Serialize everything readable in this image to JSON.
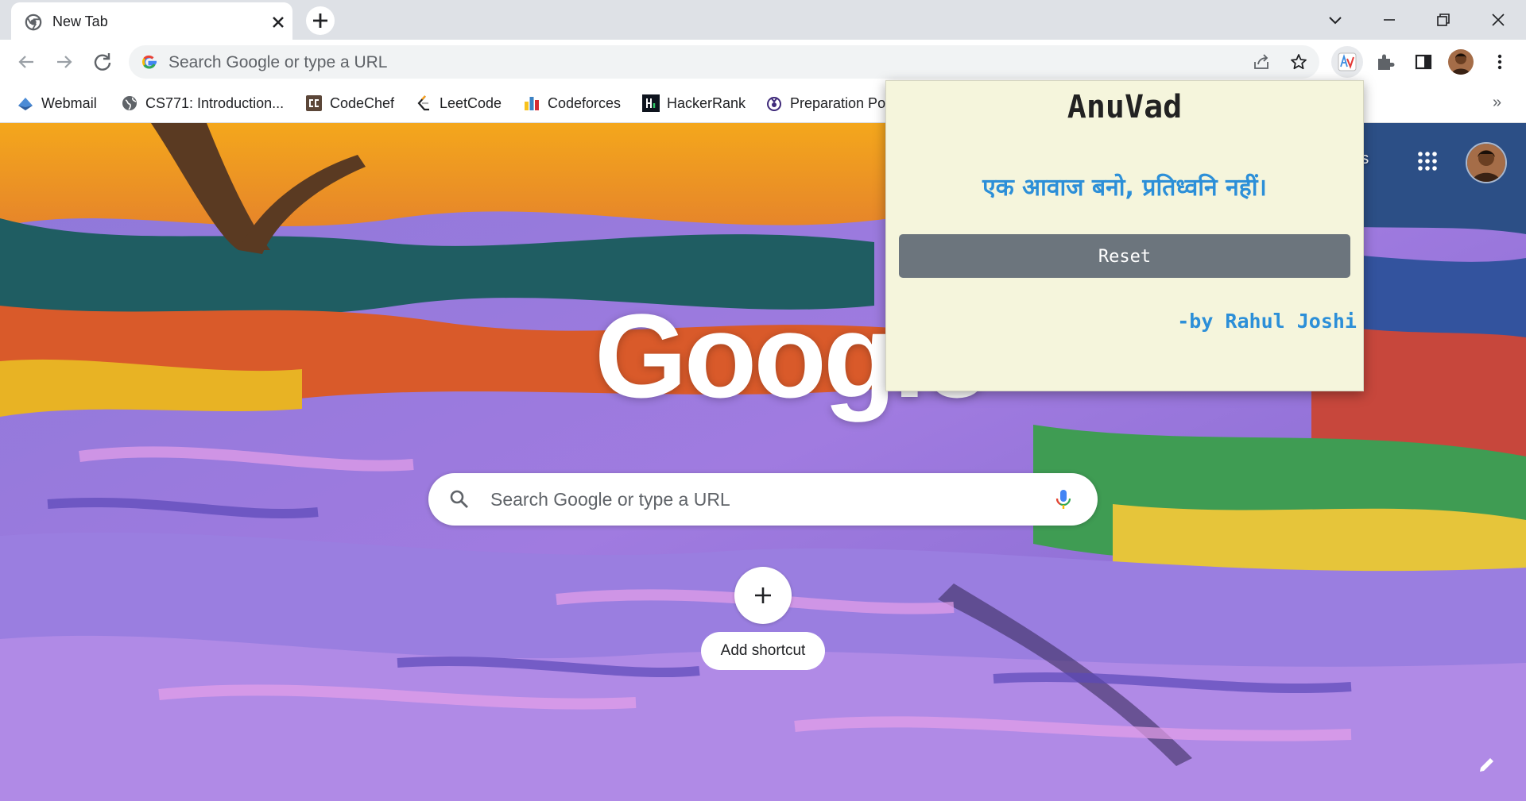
{
  "tab": {
    "title": "New Tab"
  },
  "omnibox": {
    "placeholder": "Search Google or type a URL"
  },
  "bookmarks": [
    {
      "label": "Webmail",
      "icon": "webmail-icon"
    },
    {
      "label": "CS771: Introduction...",
      "icon": "globe-icon"
    },
    {
      "label": "CodeChef",
      "icon": "codechef-icon"
    },
    {
      "label": "LeetCode",
      "icon": "leetcode-icon"
    },
    {
      "label": "Codeforces",
      "icon": "codeforces-icon"
    },
    {
      "label": "HackerRank",
      "icon": "hackerrank-icon"
    },
    {
      "label": "Preparation Po",
      "icon": "preparation-icon"
    }
  ],
  "ntp": {
    "top_link": "ges",
    "logo": "Google",
    "search_placeholder": "Search Google or type a URL",
    "add_shortcut": "Add shortcut"
  },
  "popup": {
    "title": "AnuVad",
    "translation": "एक आवाज बनो, प्रतिध्वनि नहीं।",
    "reset_label": "Reset",
    "author": "-by Rahul Joshi"
  },
  "colors": {
    "popup_bg": "#f5f5dc",
    "popup_accent": "#2c8fd8",
    "reset_bg": "#6c757d"
  }
}
